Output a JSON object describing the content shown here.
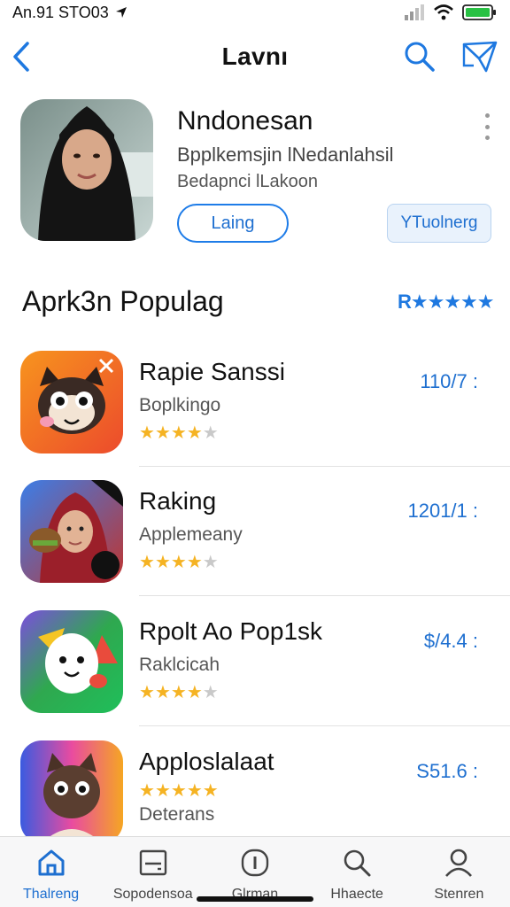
{
  "status": {
    "left_text": "An.91 STO03"
  },
  "nav": {
    "title": "Lavnı"
  },
  "featured": {
    "name": "Nndonesan",
    "subtitle1": "Bpplkemsjin lNedanlahsil",
    "subtitle2": "Bedapnci lLakoon",
    "button1": "Laing",
    "button2": "YTuolnerg"
  },
  "section": {
    "title": "Aprk3n Populag",
    "rating": "R★★★★★"
  },
  "apps": [
    {
      "name": "Rapie Sanssi",
      "subtitle": "Boplkingo",
      "price": "110/7 :",
      "rating": 4
    },
    {
      "name": "Raking",
      "subtitle": "Applemeany",
      "price": "1201/1 :",
      "rating": 4
    },
    {
      "name": "Rpolt Ao Pop1sk",
      "subtitle": "Raklcicah",
      "price": "$/4.4 :",
      "rating": 4
    },
    {
      "name": "Apploslalaat",
      "subtitle": "Deterans",
      "price": "S51.6 :",
      "rating": 5
    }
  ],
  "tabs": [
    {
      "label": "Thalreng",
      "icon": "home-icon"
    },
    {
      "label": "Sopodensoa",
      "icon": "inbox-icon"
    },
    {
      "label": "Glrman",
      "icon": "info-icon"
    },
    {
      "label": "Hhaecte",
      "icon": "search-icon"
    },
    {
      "label": "Stenren",
      "icon": "person-icon"
    }
  ],
  "colors": {
    "accent": "#1e6fd0",
    "star": "#f5b323"
  }
}
